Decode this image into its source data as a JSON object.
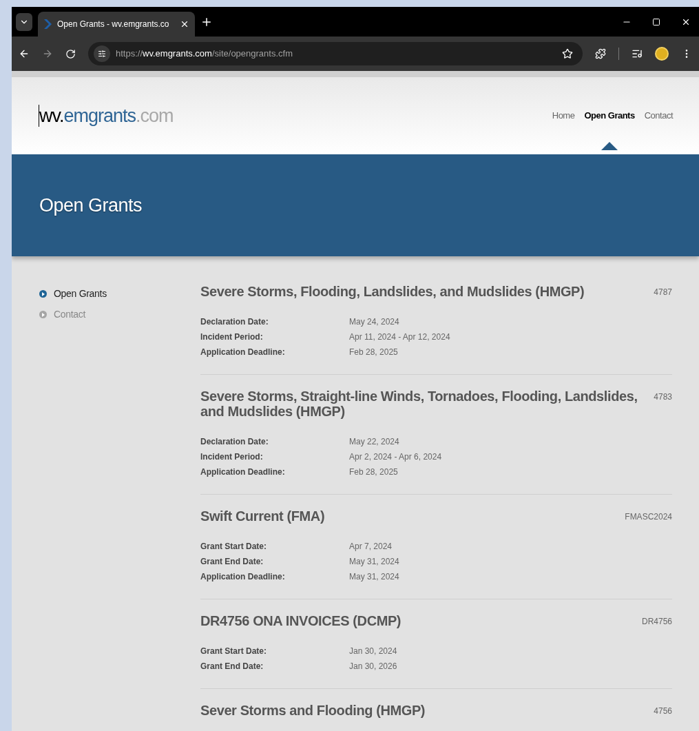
{
  "browser": {
    "tab": {
      "title": "Open Grants - wv.emgrants.co",
      "selected": true
    },
    "url": {
      "scheme": "https://",
      "host": "wv.emgrants.com",
      "path": "/site/opengrants.cfm"
    }
  },
  "site": {
    "logo": {
      "prefix": "wv.",
      "name": "emgrants",
      "suffix": ".com"
    },
    "nav": [
      {
        "label": "Home",
        "selected": false
      },
      {
        "label": "Open Grants",
        "selected": true
      },
      {
        "label": "Contact",
        "selected": false
      }
    ],
    "banner_title": "Open Grants",
    "sidebar": [
      {
        "label": "Open Grants",
        "selected": true
      },
      {
        "label": "Contact",
        "selected": false
      }
    ],
    "grants": [
      {
        "title": "Severe Storms, Flooding, Landslides, and Mudslides (HMGP)",
        "code": "4787",
        "fields": [
          {
            "label": "Declaration Date:",
            "value": "May 24, 2024"
          },
          {
            "label": "Incident Period:",
            "value": "Apr 11, 2024 - Apr 12, 2024"
          },
          {
            "label": "Application Deadline:",
            "value": "Feb 28, 2025"
          }
        ]
      },
      {
        "title": "Severe Storms, Straight-line Winds, Tornadoes, Flooding, Landslides, and Mudslides (HMGP)",
        "code": "4783",
        "fields": [
          {
            "label": "Declaration Date:",
            "value": "May 22, 2024"
          },
          {
            "label": "Incident Period:",
            "value": "Apr 2, 2024 - Apr 6, 2024"
          },
          {
            "label": "Application Deadline:",
            "value": "Feb 28, 2025"
          }
        ]
      },
      {
        "title": "Swift Current (FMA)",
        "code": "FMASC2024",
        "fields": [
          {
            "label": "Grant Start Date:",
            "value": "Apr 7, 2024"
          },
          {
            "label": "Grant End Date:",
            "value": "May 31, 2024"
          },
          {
            "label": "Application Deadline:",
            "value": "May 31, 2024"
          }
        ]
      },
      {
        "title": "DR4756 ONA INVOICES (DCMP)",
        "code": "DR4756",
        "fields": [
          {
            "label": "Grant Start Date:",
            "value": "Jan 30, 2024"
          },
          {
            "label": "Grant End Date:",
            "value": "Jan 30, 2026"
          }
        ]
      },
      {
        "title": "Sever Storms and Flooding (HMGP)",
        "code": "4756"
      }
    ]
  }
}
